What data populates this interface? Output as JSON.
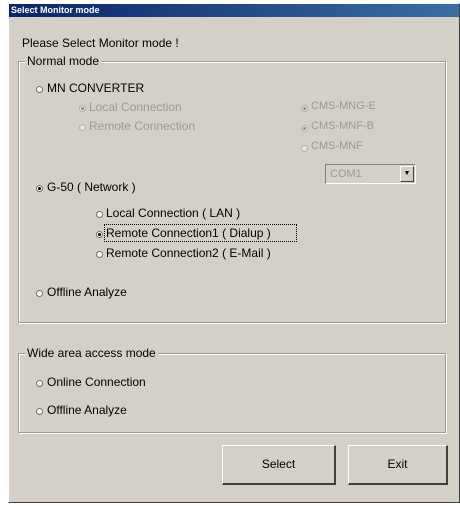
{
  "window": {
    "title": "Select Monitor mode"
  },
  "prompt": "Please Select Monitor mode !",
  "normal_mode": {
    "legend": "Normal mode",
    "mn_converter": {
      "label": "MN CONVERTER",
      "local_connection": "Local Connection",
      "remote_connection": "Remote Connection",
      "cms_mnu_e": "CMS-MNG-E",
      "cms_mnf_b": "CMS-MNF-B",
      "cms_mnf": "CMS-MNF",
      "com_port": "COM1"
    },
    "g50": {
      "label": "G-50 ( Network )",
      "local_lan": "Local Connection     ( LAN )",
      "remote_dialup": "Remote Connection1 ( Dialup )",
      "remote_email": "Remote Connection2 ( E-Mail )"
    },
    "offline": "Offline Analyze"
  },
  "wide_area": {
    "legend": "Wide area access mode",
    "online": "Online Connection",
    "offline": "Offline Analyze"
  },
  "buttons": {
    "select": "Select",
    "exit": "Exit"
  }
}
